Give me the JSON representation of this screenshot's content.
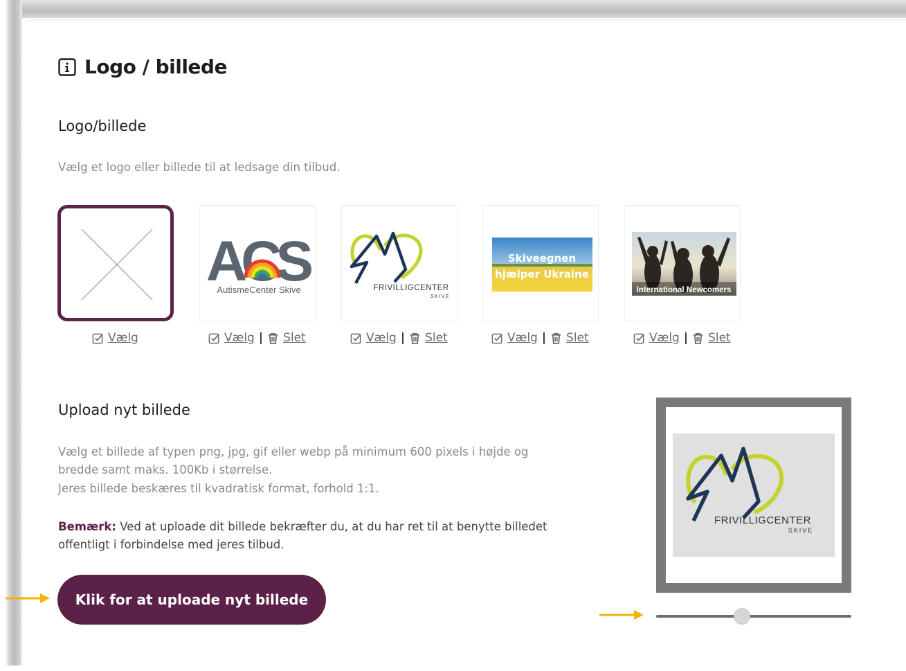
{
  "section": {
    "title": "Logo / billede",
    "icon": "info-icon"
  },
  "logo": {
    "subtitle": "Logo/billede",
    "description": "Vælg et logo eller billede til at ledsage din tilbud.",
    "select_label": "Vælg",
    "delete_label": "Slet",
    "separator": "|",
    "thumbnails": [
      {
        "name": "none-placeholder",
        "selected": true,
        "deletable": false
      },
      {
        "name": "autismecenter-skive",
        "caption": "AutismeCenter Skive",
        "selected": false,
        "deletable": true
      },
      {
        "name": "frivilligcenter-skive",
        "caption": "FRIVILLIGCENTER",
        "caption2": "SKIVE",
        "selected": false,
        "deletable": true
      },
      {
        "name": "skiveegnen-ukraine",
        "caption": "Skiveegnen",
        "caption2": "hjælper Ukraine",
        "selected": false,
        "deletable": true
      },
      {
        "name": "international-newcomers",
        "caption": "International Newcomers",
        "selected": false,
        "deletable": true
      }
    ]
  },
  "upload": {
    "subtitle": "Upload nyt billede",
    "line1": "Vælg et billede af typen png, jpg, gif eller webp på minimum 600 pixels i højde og",
    "line2": "bredde samt maks. 100Kb i størrelse.",
    "line3": "Jeres billede beskæres til kvadratisk format, forhold 1:1.",
    "note_label": "Bemærk:",
    "note_text": " Ved at uploade dit billede bekræfter du, at du har ret til at benytte billedet offentligt i forbindelse med jeres tilbud.",
    "button_label": "Klik for at uploade nyt billede"
  },
  "cropper": {
    "preview_caption": "FRIVILLIGCENTER",
    "preview_caption2": "SKIVE",
    "zoom_level": 0.44
  },
  "colors": {
    "brand": "#5b2148",
    "arrow": "#f5b400",
    "muted": "#8a8a8a"
  }
}
